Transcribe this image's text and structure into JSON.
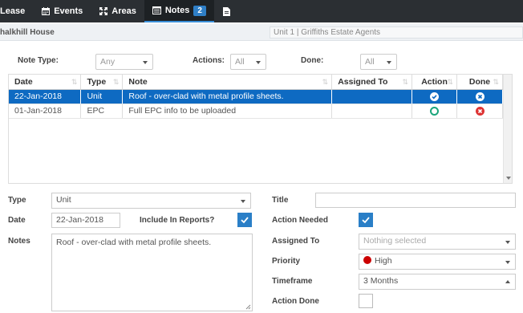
{
  "nav": {
    "tabs": [
      {
        "label": "Lease",
        "icon": "none"
      },
      {
        "label": "Events",
        "icon": "calendar-icon"
      },
      {
        "label": "Areas",
        "icon": "expand-arrows-icon"
      },
      {
        "label": "Notes",
        "icon": "list-icon",
        "badge": "2",
        "active": true
      },
      {
        "label": "",
        "icon": "document-icon"
      }
    ]
  },
  "header": {
    "title": "halkhill House",
    "address": "Unit 1 | Griffiths Estate Agents"
  },
  "filters": {
    "note_type_label": "Note Type:",
    "note_type_value": "Any",
    "actions_label": "Actions:",
    "actions_value": "All",
    "done_label": "Done:",
    "done_value": "All"
  },
  "table": {
    "columns": [
      "Date",
      "Type",
      "Note",
      "Assigned To",
      "Action",
      "Done"
    ],
    "rows": [
      {
        "date": "22-Jan-2018",
        "type": "Unit",
        "note": "Roof - over-clad with metal profile sheets.",
        "assigned": "",
        "action": "check-circle-icon",
        "done": "x-circle-icon",
        "selected": true
      },
      {
        "date": "01-Jan-2018",
        "type": "EPC",
        "note": "Full EPC info to be uploaded",
        "assigned": "",
        "action": "empty-circle-icon",
        "done": "x-circle-red-icon",
        "selected": false
      }
    ]
  },
  "form": {
    "type_label": "Type",
    "type_value": "Unit",
    "date_label": "Date",
    "date_value": "22-Jan-2018",
    "include_label": "Include In Reports?",
    "include_checked": true,
    "notes_label": "Notes",
    "notes_value": "Roof - over-clad with metal profile sheets.",
    "title_label": "Title",
    "title_value": "",
    "action_needed_label": "Action Needed",
    "action_needed_checked": true,
    "assigned_label": "Assigned To",
    "assigned_placeholder": "Nothing selected",
    "priority_label": "Priority",
    "priority_value": "High",
    "priority_color": "#cc0000",
    "timeframe_label": "Timeframe",
    "timeframe_value": "3 Months",
    "action_done_label": "Action Done",
    "action_done_checked": false
  },
  "colors": {
    "accent": "#0e6ac2",
    "nav_bg": "#2b2f33"
  }
}
